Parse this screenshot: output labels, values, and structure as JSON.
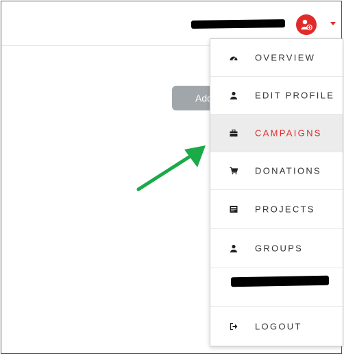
{
  "header": {
    "user_name_redacted": "",
    "avatar_icon": "user-add-icon",
    "caret_icon": "caret-down-icon",
    "accent": "#e02b2b"
  },
  "main": {
    "add_button_label": "Add"
  },
  "menu": {
    "items": [
      {
        "label": "OVERVIEW",
        "icon": "dashboard-icon"
      },
      {
        "label": "EDIT PROFILE",
        "icon": "user-icon"
      },
      {
        "label": "CAMPAIGNS",
        "icon": "briefcase-icon",
        "active": true
      },
      {
        "label": "DONATIONS",
        "icon": "cart-icon"
      },
      {
        "label": "PROJECTS",
        "icon": "list-icon"
      },
      {
        "label": "GROUPS",
        "icon": "user-icon"
      },
      {
        "label": "",
        "redacted": true
      },
      {
        "label": "LOGOUT",
        "icon": "logout-icon"
      }
    ]
  },
  "annotation": {
    "arrow_color": "#1aaa48"
  }
}
